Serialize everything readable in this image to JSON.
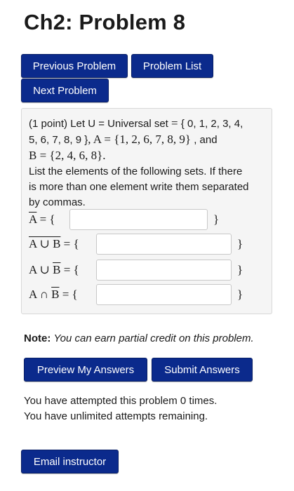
{
  "page_title": "Ch2: Problem 8",
  "nav": {
    "previous_label": "Previous Problem",
    "list_label": "Problem List",
    "next_label": "Next Problem"
  },
  "problem": {
    "points": "(1 point)",
    "line1_a": "Let U = Universal set",
    "line1_b": "{ 0, 1, 2, 3, 4,",
    "line2_a": "5, 6, 7, 8, 9 }",
    "set_A": "A = {1, 2, 6, 7, 8, 9}",
    "and": ", and",
    "set_B": "B = {2, 4, 6, 8}.",
    "instructions": [
      "List the elements of the following sets. If there",
      "is more than one element write them separated",
      "by commas."
    ],
    "rows": [
      {
        "label_over": "A",
        "label_rest": " = {",
        "value": "",
        "close": "}"
      },
      {
        "label_over": "A ∪ B",
        "label_rest": " = {",
        "value": "",
        "close": "}"
      },
      {
        "label_pre": "A ∪ ",
        "label_over": "B",
        "label_rest": " = {",
        "value": "",
        "close": "}"
      },
      {
        "label_pre": "A ∩ ",
        "label_over": "B",
        "label_rest": " = {",
        "value": "",
        "close": "}"
      }
    ]
  },
  "note": {
    "bold": "Note:",
    "italic": "You can earn partial credit on this problem."
  },
  "actions": {
    "preview_label": "Preview My Answers",
    "submit_label": "Submit Answers"
  },
  "status": {
    "attempted": "You have attempted this problem 0 times.",
    "remaining": "You have unlimited attempts remaining."
  },
  "email_label": "Email instructor",
  "colors": {
    "button_bg": "#0b2a8c",
    "panel_bg": "#f5f5f5"
  }
}
